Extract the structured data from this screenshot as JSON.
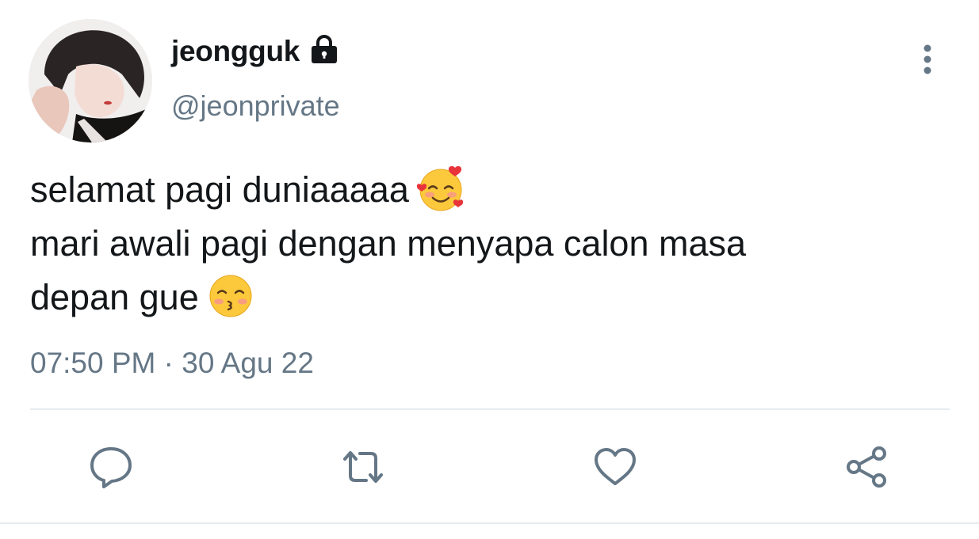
{
  "user": {
    "display_name": "jeongguk",
    "handle": "@jeonprivate",
    "lock_icon": "lock-icon",
    "avatar": "avatar"
  },
  "tweet": {
    "lines": [
      "selamat pagi duniaaaaa",
      "mari awali pagi dengan menyapa calon masa",
      "depan gue"
    ],
    "emojis": [
      "smiling-face-with-hearts-emoji",
      "kissing-face-with-smiling-eyes-emoji"
    ],
    "timestamp": "07:50 PM · 30 Agu 22"
  },
  "actions": [
    {
      "name": "reply",
      "icon": "comment-icon"
    },
    {
      "name": "retweet",
      "icon": "retweet-icon"
    },
    {
      "name": "like",
      "icon": "heart-icon"
    },
    {
      "name": "share",
      "icon": "share-icon"
    }
  ],
  "colors": {
    "text": "#14171a",
    "secondary": "#657786",
    "divider": "#e6ecf0"
  }
}
